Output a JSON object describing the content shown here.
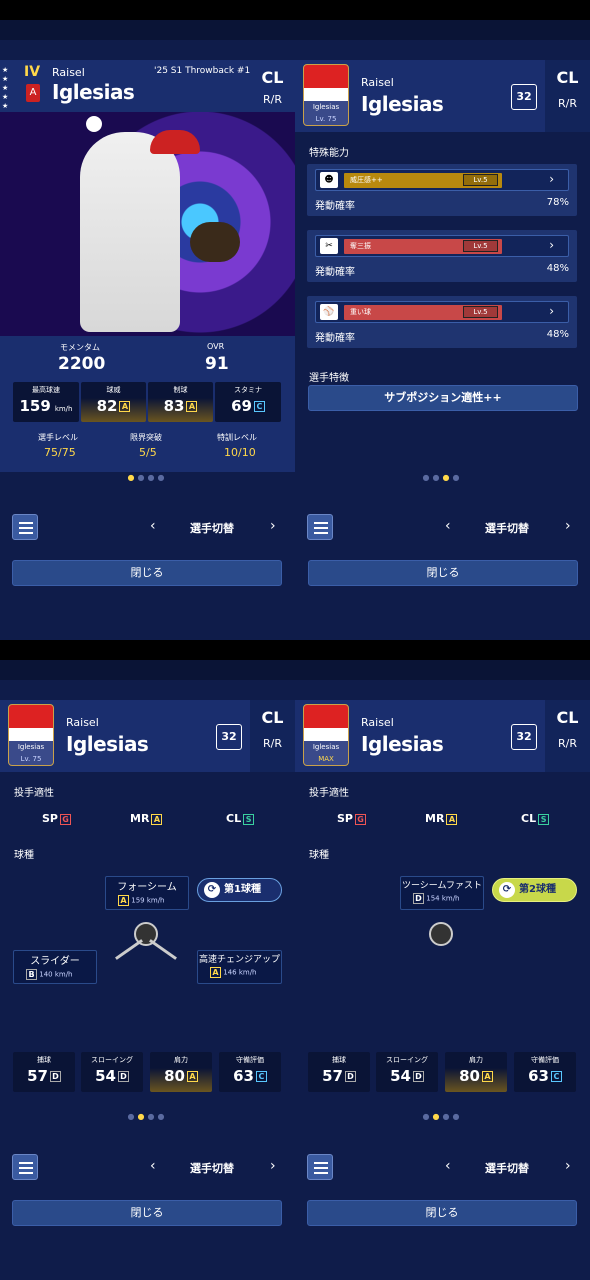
{
  "panel1": {
    "tier": "IV",
    "first_name": "Raisel",
    "last_name": "Iglesias",
    "card_series": "'25 S1 Throwback #1",
    "position": "CL",
    "handedness": "R/R",
    "momentum_label": "モメンタム",
    "momentum_value": "2200",
    "ovr_label": "OVR",
    "ovr_value": "91",
    "stats": [
      {
        "label": "最高球速",
        "value": "159",
        "unit": "km/h",
        "grade": ""
      },
      {
        "label": "球威",
        "value": "82",
        "grade": "A"
      },
      {
        "label": "制球",
        "value": "83",
        "grade": "A"
      },
      {
        "label": "スタミナ",
        "value": "69",
        "grade": "C"
      }
    ],
    "levels": [
      {
        "label": "選手レベル",
        "value": "75/75"
      },
      {
        "label": "限界突破",
        "value": "5/5"
      },
      {
        "label": "特訓レベル",
        "value": "10/10"
      }
    ]
  },
  "panel2": {
    "first_name": "Raisel",
    "last_name": "Iglesias",
    "number": "32",
    "position": "CL",
    "handedness": "R/R",
    "card_name": "Iglesias",
    "card_level": "Lv. 75",
    "special_label": "特殊能力",
    "skills": [
      {
        "name": "威圧感++",
        "level": "Lv.5",
        "rate_label": "発動確率",
        "rate": "78%",
        "color": "#b8890e"
      },
      {
        "name": "奪三振",
        "level": "Lv.5",
        "rate_label": "発動確率",
        "rate": "48%",
        "color": "#c84848"
      },
      {
        "name": "重い球",
        "level": "Lv.5",
        "rate_label": "発動確率",
        "rate": "48%",
        "color": "#c84848"
      }
    ],
    "trait_label": "選手特徴",
    "trait_button": "サブポジション適性++"
  },
  "panel3": {
    "first_name": "Raisel",
    "last_name": "Iglesias",
    "number": "32",
    "position": "CL",
    "handedness": "R/R",
    "card_name": "Iglesias",
    "card_level": "Lv. 75",
    "apt_label": "投手適性",
    "apt": [
      {
        "pos": "SP",
        "grade": "G"
      },
      {
        "pos": "MR",
        "grade": "A"
      },
      {
        "pos": "CL",
        "grade": "S"
      }
    ],
    "pitch_label": "球種",
    "rank_pill": "第1球種",
    "pitches": [
      {
        "name": "フォーシーム",
        "grade": "A",
        "speed": "159 km/h"
      },
      {
        "name": "スライダー",
        "grade": "B",
        "speed": "140 km/h"
      },
      {
        "name": "高速チェンジアップ",
        "grade": "A",
        "speed": "146 km/h"
      }
    ],
    "fielding": [
      {
        "label": "捕球",
        "value": "57",
        "grade": "D"
      },
      {
        "label": "スローイング",
        "value": "54",
        "grade": "D"
      },
      {
        "label": "肩力",
        "value": "80",
        "grade": "A"
      },
      {
        "label": "守備評価",
        "value": "63",
        "grade": "C"
      }
    ]
  },
  "panel4": {
    "first_name": "Raisel",
    "last_name": "Iglesias",
    "number": "32",
    "position": "CL",
    "handedness": "R/R",
    "card_name": "Iglesias",
    "card_level": "MAX",
    "apt_label": "投手適性",
    "apt": [
      {
        "pos": "SP",
        "grade": "G"
      },
      {
        "pos": "MR",
        "grade": "A"
      },
      {
        "pos": "CL",
        "grade": "S"
      }
    ],
    "pitch_label": "球種",
    "rank_pill": "第2球種",
    "pitches": [
      {
        "name": "ツーシームファスト",
        "grade": "D",
        "speed": "154 km/h"
      }
    ],
    "fielding": [
      {
        "label": "捕球",
        "value": "57",
        "grade": "D"
      },
      {
        "label": "スローイング",
        "value": "54",
        "grade": "D"
      },
      {
        "label": "肩力",
        "value": "80",
        "grade": "A"
      },
      {
        "label": "守備評価",
        "value": "63",
        "grade": "C"
      }
    ]
  },
  "nav": {
    "switch_label": "選手切替",
    "prev": "‹",
    "next": "›",
    "close_label": "閉じる"
  },
  "colors": {
    "bg": "#0f1c4a",
    "header": "#1a2e6e",
    "accent_gold": "#ffd84a",
    "pill_green": "#c8d84a"
  }
}
